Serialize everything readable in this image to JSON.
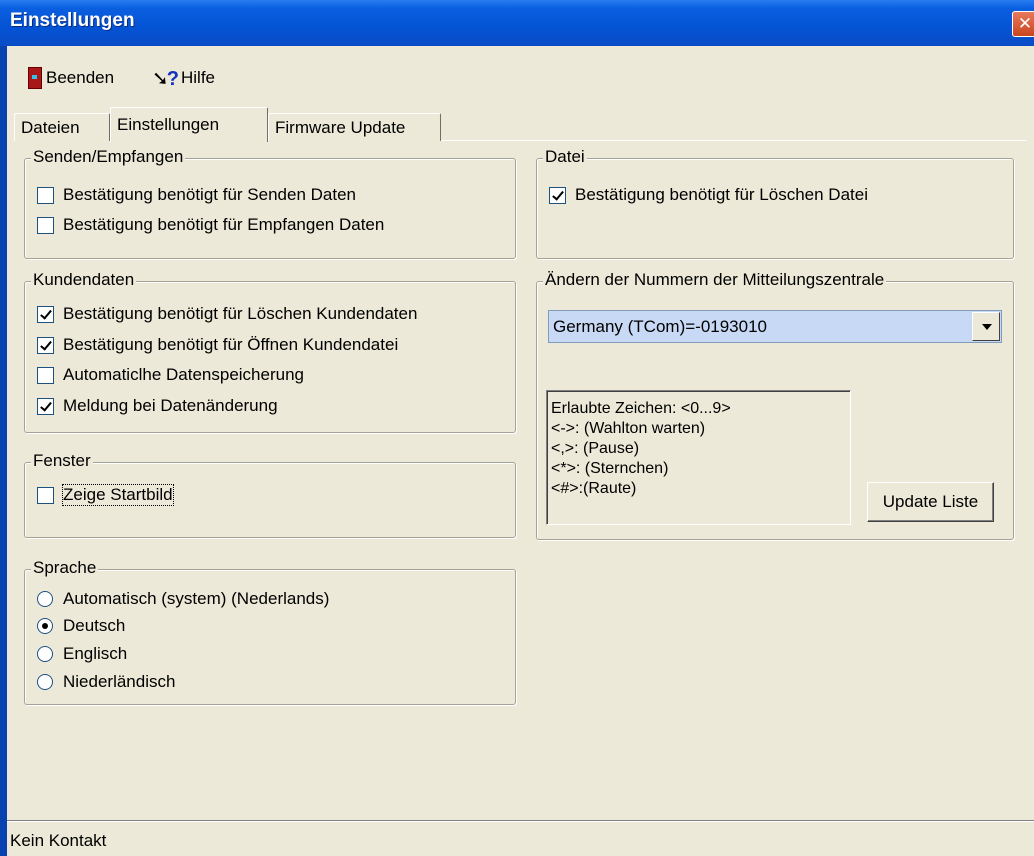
{
  "window": {
    "title": "Einstellungen",
    "close_glyph": "✕"
  },
  "toolbar": {
    "quit_label": "Beenden",
    "help_label": "Hilfe"
  },
  "tabs": [
    "Dateien",
    "Einstellungen",
    "Firmware Update"
  ],
  "send_receive": {
    "title": "Senden/Empfangen",
    "items": [
      {
        "label": "Bestätigung benötigt für Senden Daten",
        "checked": false
      },
      {
        "label": "Bestätigung benötigt für Empfangen Daten",
        "checked": false
      }
    ]
  },
  "customer_data": {
    "title": "Kundendaten",
    "items": [
      {
        "label": "Bestätigung benötigt für Löschen Kundendaten",
        "checked": true
      },
      {
        "label": "Bestätigung benötigt für Öffnen Kundendatei",
        "checked": true
      },
      {
        "label": "Automaticlhe Datenspeicherung",
        "checked": false
      },
      {
        "label": "Meldung bei Datenänderung",
        "checked": true
      }
    ]
  },
  "window_group": {
    "title": "Fenster",
    "items": [
      {
        "label": "Zeige Startbild",
        "checked": false
      }
    ]
  },
  "language": {
    "title": "Sprache",
    "options": [
      "Automatisch (system) (Nederlands)",
      "Deutsch",
      "Englisch",
      "Niederländisch"
    ],
    "selected": "Deutsch"
  },
  "file_group": {
    "title": "Datei",
    "items": [
      {
        "label": "Bestätigung benötigt für Löschen Datei",
        "checked": true
      }
    ]
  },
  "message_center": {
    "title": "Ändern der Nummern der Mitteilungszentrale",
    "selected_value": "Germany (TCom)=-0193010",
    "allowed_chars": [
      "Erlaubte Zeichen: <0...9>",
      "<->: (Wahlton warten)",
      "<,>: (Pause)",
      "<*>: (Sternchen)",
      "<#>:(Raute)"
    ],
    "update_button": "Update Liste"
  },
  "status": {
    "text": "Kein Kontakt"
  }
}
